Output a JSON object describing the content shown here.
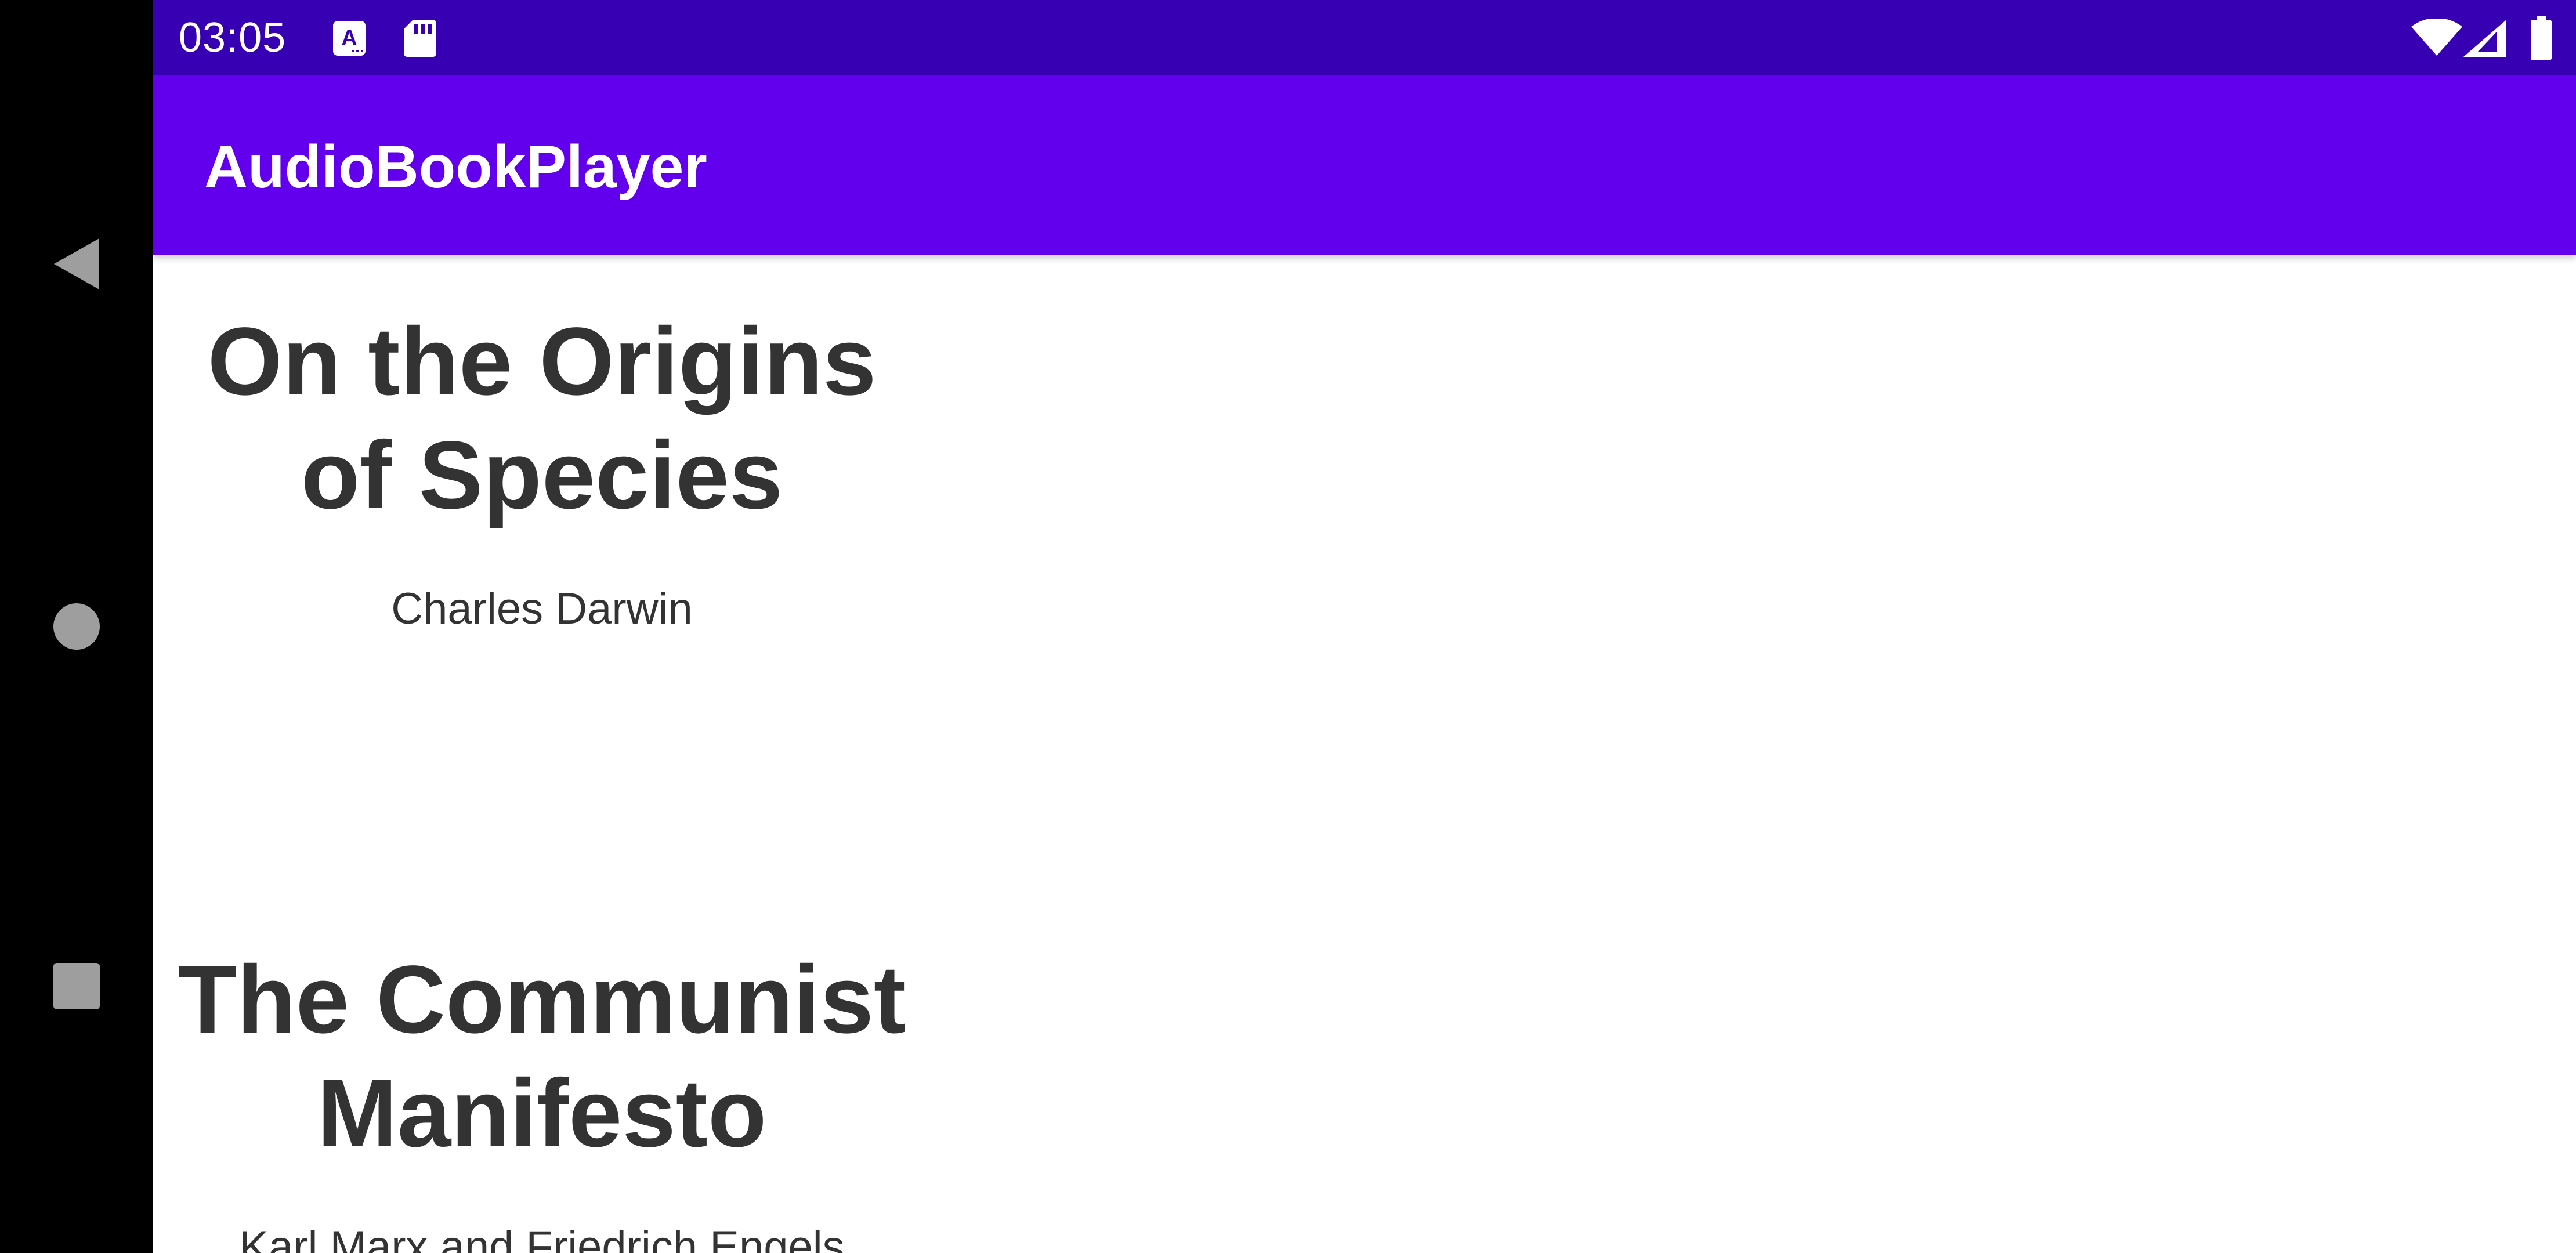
{
  "status_bar": {
    "time": "03:05",
    "left_icons": [
      "text-accessibility-icon",
      "sd-card-icon"
    ],
    "right_icons": [
      "wifi-icon",
      "cellular-signal-icon",
      "battery-icon"
    ]
  },
  "app_bar": {
    "title": "AudioBookPlayer"
  },
  "books": [
    {
      "title": "On the Origins of Species",
      "author": "Charles Darwin"
    },
    {
      "title": "The Communist Manifesto",
      "author": "Karl Marx and Friedrich Engels"
    }
  ],
  "navigation": {
    "buttons": [
      "back-icon",
      "home-icon",
      "recents-icon"
    ]
  },
  "colors": {
    "status_bar": "#3700B3",
    "app_bar": "#6200EE",
    "text": "#333333",
    "nav_icon": "#9E9E9E"
  }
}
